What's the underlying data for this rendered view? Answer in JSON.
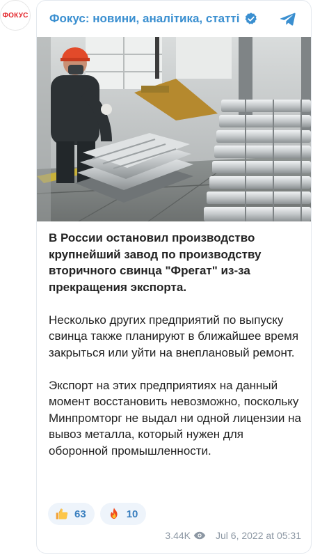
{
  "channel": {
    "avatar_text": "ФОКУС",
    "name": "Фокус: новини, аналітика, статті",
    "verified_icon": "verified-badge-icon",
    "platform_icon": "telegram-icon",
    "brand_color": "#3a8fd0",
    "avatar_color": "#e32227"
  },
  "post": {
    "image_icon": "photo-factory-lead-ingots",
    "paragraphs": [
      "В России остановил производство крупнейший завод по производству вторичного свинца \"Фрегат\" из-за прекращения экспорта.",
      "Несколько других предприятий по выпуску свинца также планируют в ближайшее время закрыться или уйти на внеплановый ремонт.",
      "Экспорт на этих предприятиях на данный момент восстановить невозможно, поскольку Минпромторг не выдал ни одной лицензии на вывоз металла, который нужен для оборонной промышленности."
    ]
  },
  "reactions": [
    {
      "icon": "thumbs-up-icon",
      "count": "63"
    },
    {
      "icon": "fire-icon",
      "count": "10"
    }
  ],
  "footer": {
    "views": "3.44K",
    "views_icon": "eye-icon",
    "date": "Jul 6, 2022 at 05:31"
  }
}
